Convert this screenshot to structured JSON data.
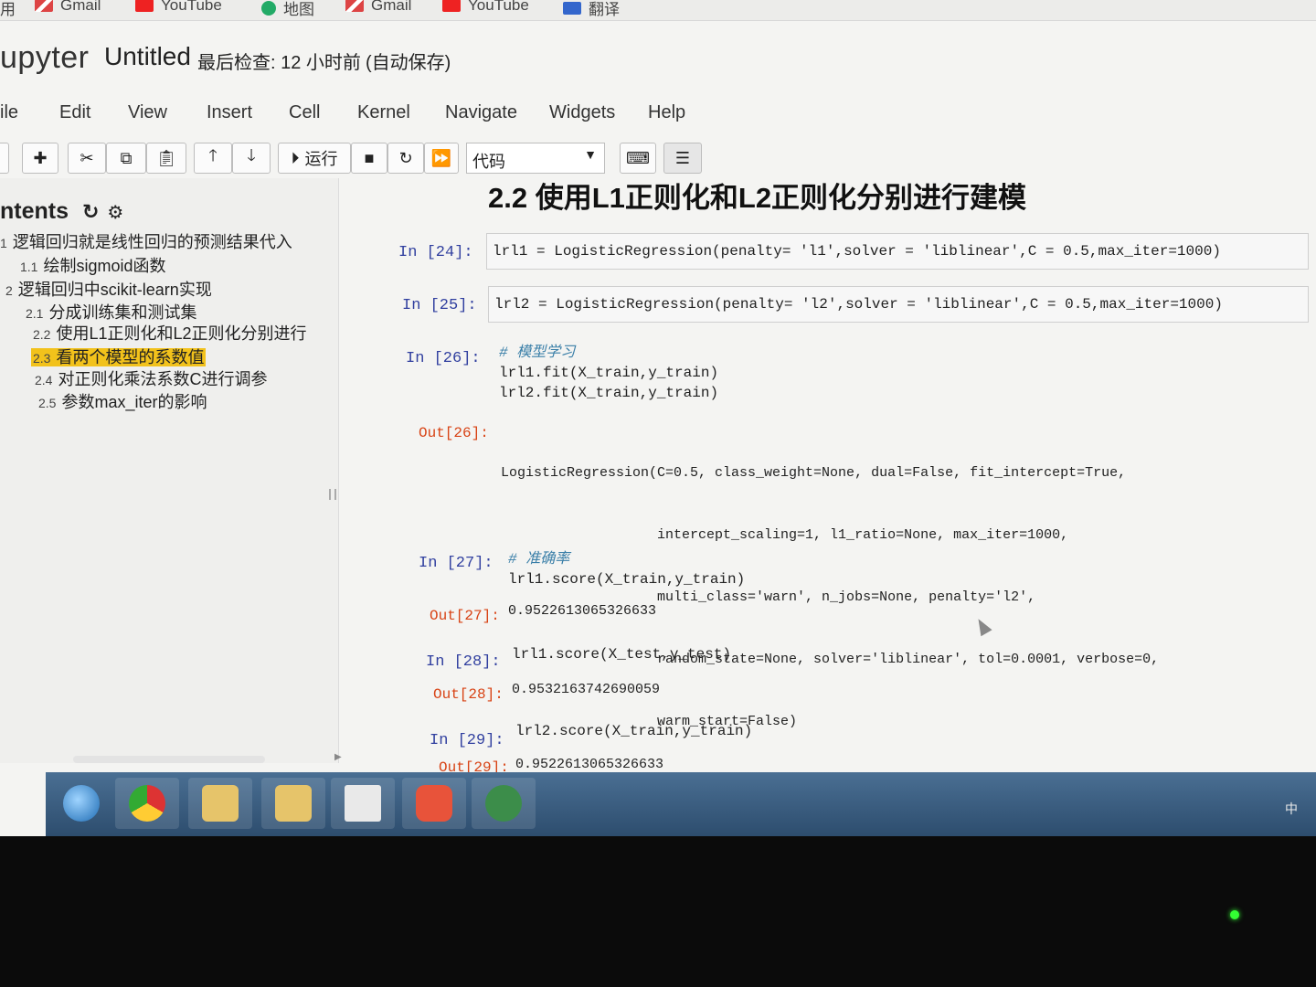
{
  "bookmarks": [
    {
      "label": "用",
      "icon": "apps-icon"
    },
    {
      "label": "Gmail",
      "icon": "gmail-icon"
    },
    {
      "label": "YouTube",
      "icon": "youtube-icon"
    },
    {
      "label": "地图",
      "icon": "maps-icon"
    },
    {
      "label": "Gmail",
      "icon": "gmail-icon"
    },
    {
      "label": "YouTube",
      "icon": "youtube-icon"
    },
    {
      "label": "翻译",
      "icon": "translate-icon"
    }
  ],
  "header": {
    "logo": "upyter",
    "notebook_name": "Untitled",
    "checkpoint": "最后检查: 12 小时前",
    "autosave": "(自动保存)"
  },
  "menu": [
    "ile",
    "Edit",
    "View",
    "Insert",
    "Cell",
    "Kernel",
    "Navigate",
    "Widgets",
    "Help"
  ],
  "toolbar": {
    "run_label": "运行",
    "cell_type": "代码"
  },
  "toc": {
    "title": "ntents",
    "items": [
      {
        "num": "1",
        "label": "逻辑回归就是线性回归的预测结果代入"
      },
      {
        "num": "1.1",
        "label": "绘制sigmoid函数"
      },
      {
        "num": "2",
        "label": "逻辑回归中scikit-learn实现"
      },
      {
        "num": "2.1",
        "label": "分成训练集和测试集"
      },
      {
        "num": "2.2",
        "label": "使用L1正则化和L2正则化分别进行"
      },
      {
        "num": "2.3",
        "label": "看两个模型的系数值"
      },
      {
        "num": "2.4",
        "label": "对正则化乘法系数C进行调参"
      },
      {
        "num": "2.5",
        "label": "参数max_iter的影响"
      }
    ]
  },
  "notebook": {
    "heading": "2.2  使用L1正则化和L2正则化分别进行建模",
    "cells": [
      {
        "in": "In  [24]:",
        "code": [
          "lrl1 = LogisticRegression(penalty= 'l1',solver = 'liblinear',C = 0.5,max_iter=1000)"
        ]
      },
      {
        "in": "In  [25]:",
        "code": [
          "lrl2 = LogisticRegression(penalty= 'l2',solver = 'liblinear',C = 0.5,max_iter=1000)"
        ]
      },
      {
        "in": "In  [26]:",
        "comment": "# 模型学习",
        "code": [
          "lrl1.fit(X_train,y_train)",
          "lrl2.fit(X_train,y_train)"
        ],
        "out": "Out[26]:",
        "output": [
          "LogisticRegression(C=0.5, class_weight=None, dual=False, fit_intercept=True,",
          "                   intercept_scaling=1, l1_ratio=None, max_iter=1000,",
          "                   multi_class='warn', n_jobs=None, penalty='l2',",
          "                   random_state=None, solver='liblinear', tol=0.0001, verbose=0,",
          "                   warm_start=False)"
        ]
      },
      {
        "in": "In  [27]:",
        "comment": "# 准确率",
        "code": [
          "lrl1.score(X_train,y_train)"
        ],
        "out": "Out[27]:",
        "output": [
          "0.9522613065326633"
        ]
      },
      {
        "in": "In  [28]:",
        "code": [
          "lrl1.score(X_test,y_test)"
        ],
        "out": "Out[28]:",
        "output": [
          "0.9532163742690059"
        ]
      },
      {
        "in": "In  [29]:",
        "code": [
          "lrl2.score(X_train,y_train)"
        ],
        "out": "Out[29]:",
        "output": [
          "0.9522613065326633"
        ]
      }
    ]
  },
  "taskbar": {
    "tray_text": "中"
  }
}
